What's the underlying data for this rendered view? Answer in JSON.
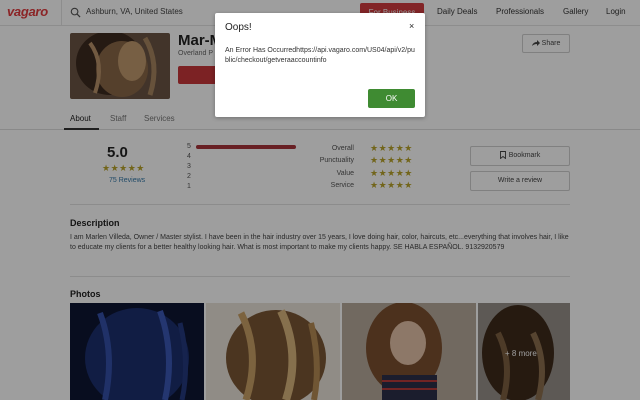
{
  "topbar": {
    "logo": "vagaro",
    "search_value": "Ashburn, VA, United States",
    "for_business": "For Business",
    "nav": [
      "Daily Deals",
      "Professionals",
      "Gallery",
      "Login"
    ]
  },
  "header": {
    "business_name": "Mar-M",
    "location": "Overland P",
    "share": "Share"
  },
  "tabs": [
    "About",
    "Staff",
    "Services"
  ],
  "ratings": {
    "score": "5.0",
    "reviews": "75 Reviews",
    "distribution": [
      {
        "label": "5",
        "fraction": 1.0
      },
      {
        "label": "4",
        "fraction": 0
      },
      {
        "label": "3",
        "fraction": 0
      },
      {
        "label": "2",
        "fraction": 0
      },
      {
        "label": "1",
        "fraction": 0
      }
    ],
    "categories": [
      "Overall",
      "Punctuality",
      "Value",
      "Service"
    ],
    "star_color": "#b8a32a"
  },
  "actions": {
    "bookmark": "Bookmark",
    "write_review": "Write a review"
  },
  "description": {
    "title": "Description",
    "text": "I am Marlen Villeda, Owner / Master stylist. I have been in the hair industry over 15 years, I love doing hair, color, haircuts, etc...everything that involves hair, I like to educate my clients for a better healthy looking hair. What is most important to make my clients happy. SE HABLA ESPAÑOL. 9132920579"
  },
  "photos": {
    "title": "Photos",
    "more": "+ 8 more"
  },
  "modal": {
    "title": "Oops!",
    "close": "×",
    "message": "An Error Has Occurredhttps://api.vagaro.com/US04/api/v2/public/checkout/getveraaccountinfo",
    "ok": "OK"
  }
}
